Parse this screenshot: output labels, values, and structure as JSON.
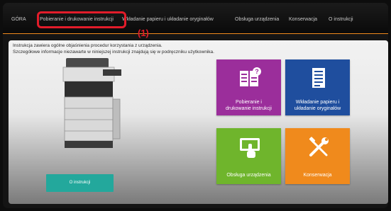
{
  "nav": {
    "home": "GÓRA",
    "print": "Pobieranie i drukowanie instrukcji",
    "paper": "Wkładanie papieru i układanie oryginałów",
    "ops": "Obsługa urządzenia",
    "maintenance": "Konserwacja",
    "about": "O instrukcji"
  },
  "callout": "(1)",
  "intro": {
    "line1": "Instrukcja zawiera ogólne objaśnienia procedur korzystania z urządzenia.",
    "line2": "Szczegółowe informacje niezawarte w niniejszej instrukcji znajdują się w podręczniku użytkownika."
  },
  "about_button": "O instrukcji",
  "tiles": {
    "print": {
      "line1": "Pobieranie i",
      "line2": "drukowanie instrukcji",
      "color": "#9b2e9b"
    },
    "paper": {
      "line1": "Wkładanie papieru i",
      "line2": "układanie oryginałów",
      "color": "#1f4e9e"
    },
    "ops": {
      "label": "Obsługa urządzenia",
      "color": "#6fb52c"
    },
    "maintenance": {
      "label": "Konserwacja",
      "color": "#f08a1c"
    }
  },
  "colors": {
    "highlight": "#e21c2a",
    "accent": "#f08a1c",
    "about_button": "#23a89c"
  },
  "icons": [
    "document-question-icon",
    "document-list-icon",
    "touch-panel-icon",
    "tools-icon",
    "printer-illustration"
  ]
}
